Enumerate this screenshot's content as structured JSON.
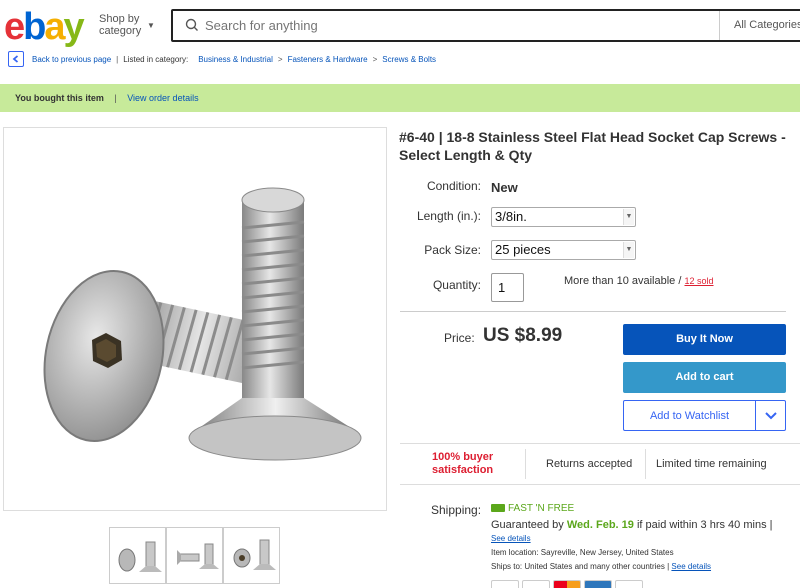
{
  "header": {
    "logo": [
      "e",
      "b",
      "a",
      "y"
    ],
    "logo_colors": [
      "#e53238",
      "#0064d2",
      "#f5af02",
      "#86b817"
    ],
    "shop_by": "Shop by",
    "category": "category",
    "search_placeholder": "Search for anything",
    "search_category": "All Categories"
  },
  "breadcrumb": {
    "back": "Back to previous page",
    "listed_in": "Listed in category:",
    "items": [
      "Business & Industrial",
      "Fasteners & Hardware",
      "Screws & Bolts"
    ]
  },
  "notice": {
    "text": "You bought this item",
    "link": "View order details"
  },
  "product": {
    "title": "#6-40 | 18-8 Stainless Steel Flat Head Socket Cap Screws - Select Length & Qty",
    "condition_label": "Condition:",
    "condition_value": "New",
    "length_label": "Length (in.):",
    "length_value": "3/8in.",
    "pack_label": "Pack Size:",
    "pack_value": "25 pieces",
    "quantity_label": "Quantity:",
    "quantity_value": "1",
    "availability": "More than 10 available /",
    "sold": "12 sold",
    "price_label": "Price:",
    "price_value": "US $8.99"
  },
  "actions": {
    "buy": "Buy It Now",
    "cart": "Add to cart",
    "watch": "Add to Watchlist"
  },
  "badges": {
    "satisfaction": "100% buyer satisfaction",
    "returns": "Returns accepted",
    "limited": "Limited time remaining"
  },
  "shipping": {
    "label": "Shipping:",
    "fast": "FAST 'N FREE",
    "guaranteed_prefix": "Guaranteed by",
    "date": "Wed. Feb. 19",
    "guaranteed_suffix": "if paid within 3 hrs 40 mins |",
    "see_details": "See details",
    "location": "Item location:  Sayreville, New Jersey, United States",
    "ships_to": "Ships to:  United States and many other countries |",
    "ships_details": "See details"
  }
}
